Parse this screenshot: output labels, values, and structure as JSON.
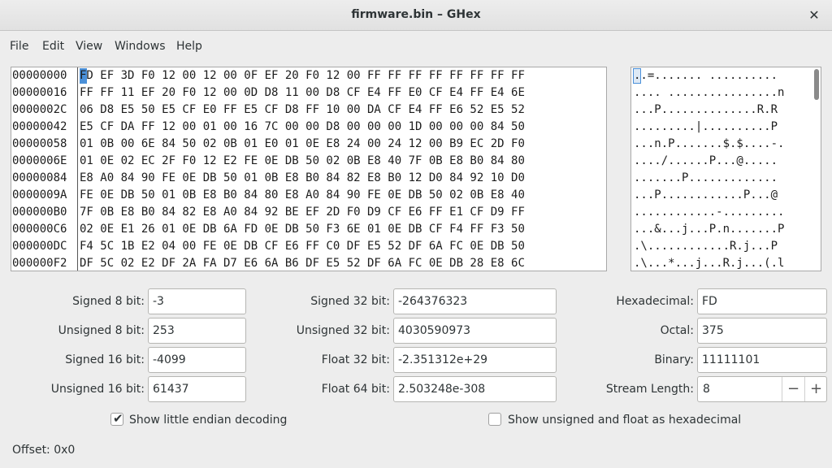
{
  "window": {
    "title": "firmware.bin – GHex",
    "close_glyph": "✕"
  },
  "menu": [
    {
      "label": "File"
    },
    {
      "label": "Edit"
    },
    {
      "label": "View"
    },
    {
      "label": "Windows"
    },
    {
      "label": "Help"
    }
  ],
  "hex_view": {
    "offsets": [
      "00000000",
      "00000016",
      "0000002C",
      "00000042",
      "00000058",
      "0000006E",
      "00000084",
      "0000009A",
      "000000B0",
      "000000C6",
      "000000DC",
      "000000F2"
    ],
    "hex_rows": [
      "FD EF 3D F0 12 00 12 00 0F EF 20 F0 12 00 FF FF FF FF FF FF FF FF",
      "FF FF 11 EF 20 F0 12 00 0D D8 11 00 D8 CF E4 FF E0 CF E4 FF E4 6E",
      "06 D8 E5 50 E5 CF E0 FF E5 CF D8 FF 10 00 DA CF E4 FF E6 52 E5 52",
      "E5 CF DA FF 12 00 01 00 16 7C 00 00 D8 00 00 00 1D 00 00 00 84 50",
      "01 0B 00 6E 84 50 02 0B 01 E0 01 0E E8 24 00 24 12 00 B9 EC 2D F0",
      "01 0E 02 EC 2F F0 12 E2 FE 0E DB 50 02 0B E8 40 7F 0B E8 B0 84 80",
      "E8 A0 84 90 FE 0E DB 50 01 0B E8 B0 84 82 E8 B0 12 D0 84 92 10 D0",
      "FE 0E DB 50 01 0B E8 B0 84 80 E8 A0 84 90 FE 0E DB 50 02 0B E8 40",
      "7F 0B E8 B0 84 82 E8 A0 84 92 BE EF 2D F0 D9 CF E6 FF E1 CF D9 FF",
      "02 0E E1 26 01 0E DB 6A FD 0E DB 50 F3 6E 01 0E DB CF F4 FF F3 50",
      "F4 5C 1B E2 04 00 FE 0E DB CF E6 FF C0 DF E5 52 DF 6A FC 0E DB 50",
      "DF 5C 02 E2 DF 2A FA D7 E6 6A B6 DF E5 52 DF 6A FC 0E DB 28 E8 6C"
    ],
    "ascii_rows": [
      "..=....... ..........",
      ".... ................n",
      "...P..............R.R",
      ".........|..........P",
      "...n.P.......$.$....-.",
      "..../......P...@.....",
      ".......P.............",
      "...P............P...@",
      "............-.........",
      "...&...j...P.n.......P",
      ".\\............R.j...P",
      ".\\...*...j...R.j...(.l"
    ]
  },
  "decoders": {
    "signed8": {
      "label": "Signed 8 bit:",
      "value": "-3"
    },
    "unsigned8": {
      "label": "Unsigned 8 bit:",
      "value": "253"
    },
    "signed16": {
      "label": "Signed 16 bit:",
      "value": "-4099"
    },
    "unsigned16": {
      "label": "Unsigned 16 bit:",
      "value": "61437"
    },
    "signed32": {
      "label": "Signed 32 bit:",
      "value": "-264376323"
    },
    "unsigned32": {
      "label": "Unsigned 32 bit:",
      "value": "4030590973"
    },
    "float32": {
      "label": "Float 32 bit:",
      "value": "-2.351312e+29"
    },
    "float64": {
      "label": "Float 64 bit:",
      "value": "2.503248e-308"
    },
    "hexadecimal": {
      "label": "Hexadecimal:",
      "value": "FD"
    },
    "octal": {
      "label": "Octal:",
      "value": "375"
    },
    "binary": {
      "label": "Binary:",
      "value": "11111101"
    },
    "stream_length": {
      "label": "Stream Length:",
      "value": "8",
      "minus": "−",
      "plus": "+"
    }
  },
  "options": {
    "little_endian": {
      "label": "Show little endian decoding",
      "checked": true,
      "mark": "✔"
    },
    "unsigned_hex": {
      "label": "Show unsigned and float as hexadecimal",
      "checked": false
    }
  },
  "status": {
    "offset_text": "Offset: 0x0"
  }
}
